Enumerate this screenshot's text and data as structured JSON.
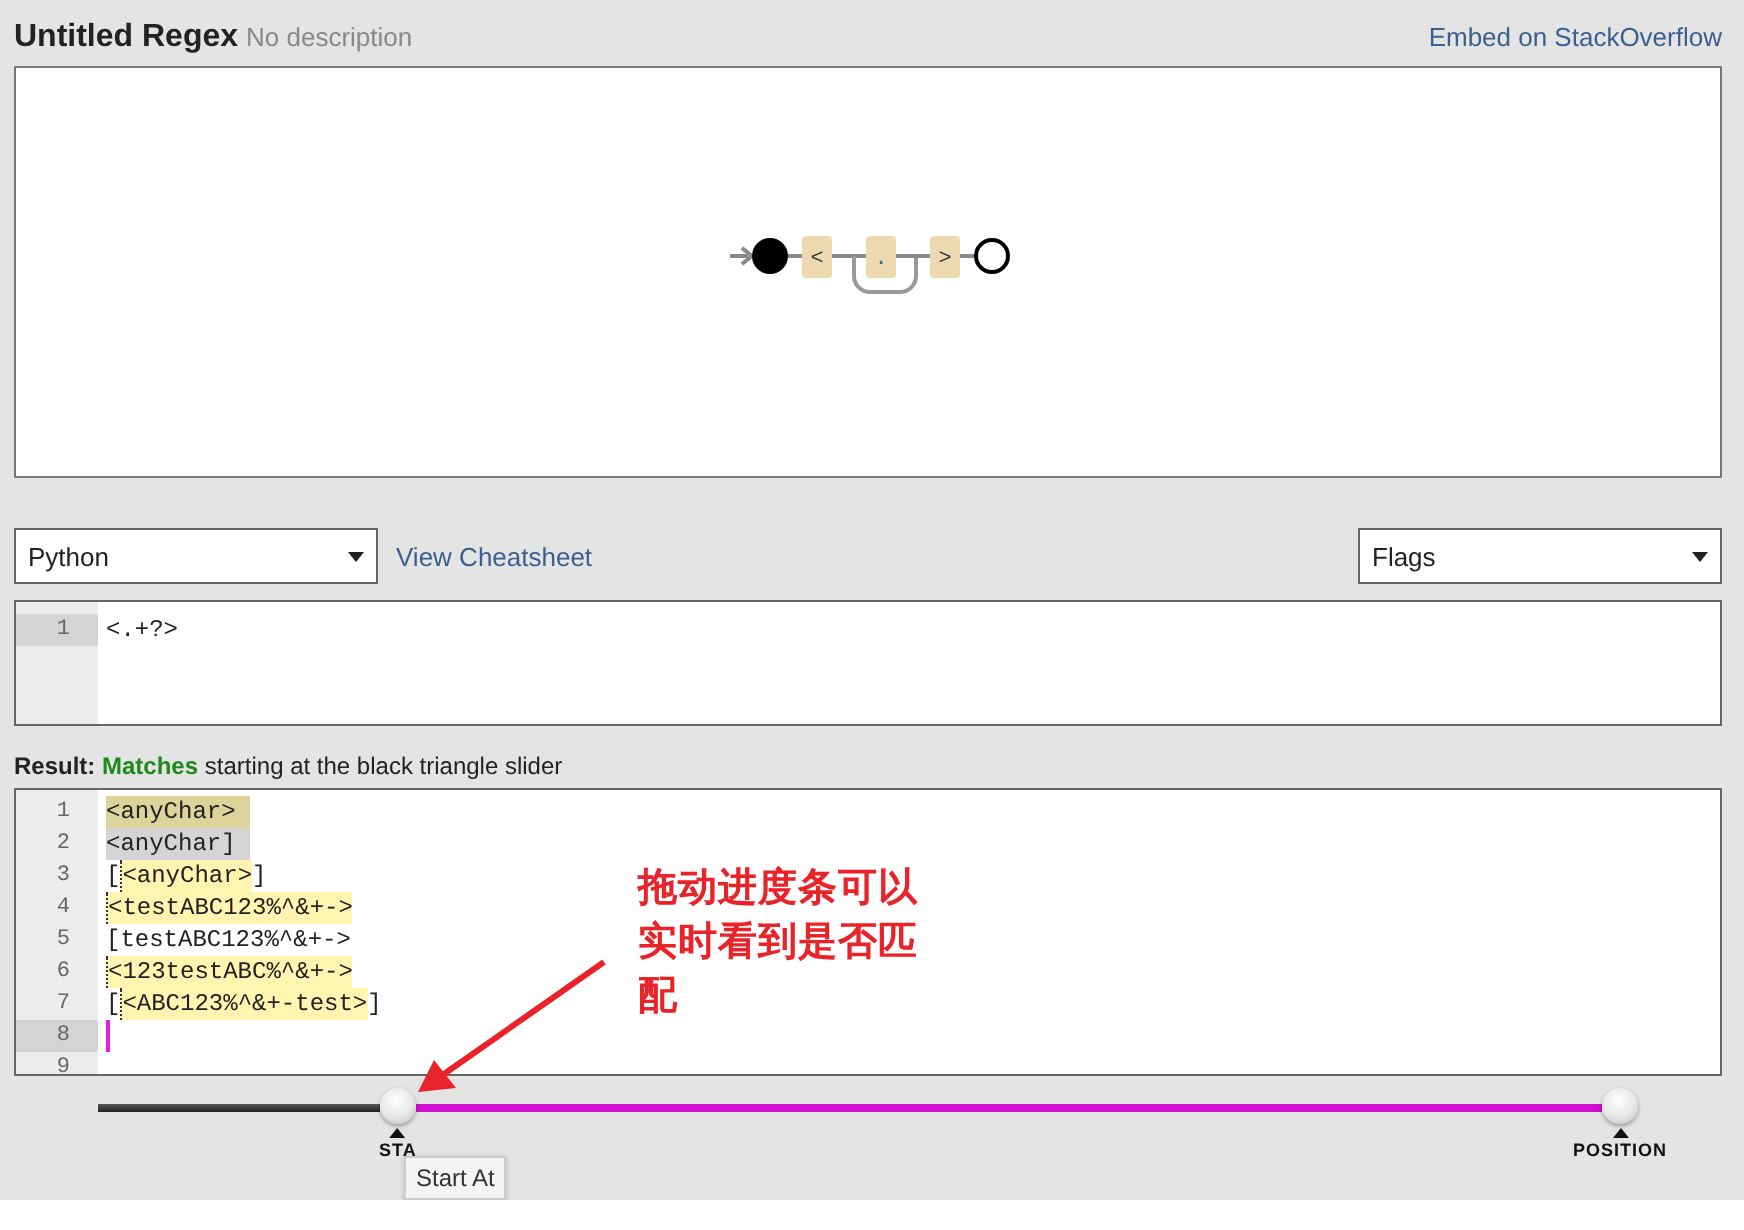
{
  "header": {
    "title": "Untitled Regex",
    "description": "No description",
    "embed_link": "Embed on StackOverflow"
  },
  "diagram": {
    "nodes": [
      {
        "kind": "start"
      },
      {
        "kind": "literal",
        "text": "<"
      },
      {
        "kind": "repeat",
        "text": "."
      },
      {
        "kind": "literal",
        "text": ">"
      },
      {
        "kind": "end"
      }
    ]
  },
  "controls": {
    "flavor": "Python",
    "cheatsheet_link": "View Cheatsheet",
    "flags": "Flags"
  },
  "regex_editor": {
    "lines": [
      {
        "number": "1",
        "active": true,
        "segments": [
          {
            "text": "<.+?>",
            "kind": "plain"
          }
        ]
      }
    ]
  },
  "result": {
    "label": "Result:",
    "status": "Matches",
    "description": "starting at the black triangle slider"
  },
  "result_editor": {
    "lines": [
      {
        "number": "1",
        "active": false,
        "segments": [
          {
            "text": "<anyChar>",
            "kind": "selected-match"
          }
        ]
      },
      {
        "number": "2",
        "active": false,
        "segments": [
          {
            "text": "<anyChar]",
            "kind": "selected"
          }
        ]
      },
      {
        "number": "3",
        "active": false,
        "segments": [
          {
            "text": "[",
            "kind": "plain"
          },
          {
            "text": "<anyChar>",
            "kind": "match"
          },
          {
            "text": "]",
            "kind": "plain"
          }
        ]
      },
      {
        "number": "4",
        "active": false,
        "segments": [
          {
            "text": "<testABC123%^&+->",
            "kind": "match"
          }
        ]
      },
      {
        "number": "5",
        "active": false,
        "segments": [
          {
            "text": "[testABC123%^&+->",
            "kind": "plain"
          }
        ]
      },
      {
        "number": "6",
        "active": false,
        "segments": [
          {
            "text": "<123testABC%^&+->",
            "kind": "match"
          }
        ]
      },
      {
        "number": "7",
        "active": false,
        "segments": [
          {
            "text": "[",
            "kind": "plain"
          },
          {
            "text": "<ABC123%^&+-test>",
            "kind": "match"
          },
          {
            "text": "]",
            "kind": "plain"
          }
        ]
      },
      {
        "number": "8",
        "active": true,
        "cursor": true
      },
      {
        "number": "9",
        "active": false
      }
    ]
  },
  "slider": {
    "start": {
      "label": "STA",
      "level": 0.197
    },
    "position": {
      "label": "POSITION",
      "level": 1
    },
    "tooltip": "Start At"
  },
  "annotation": {
    "text": "拖动进度条可以实时看到是否匹配"
  }
}
